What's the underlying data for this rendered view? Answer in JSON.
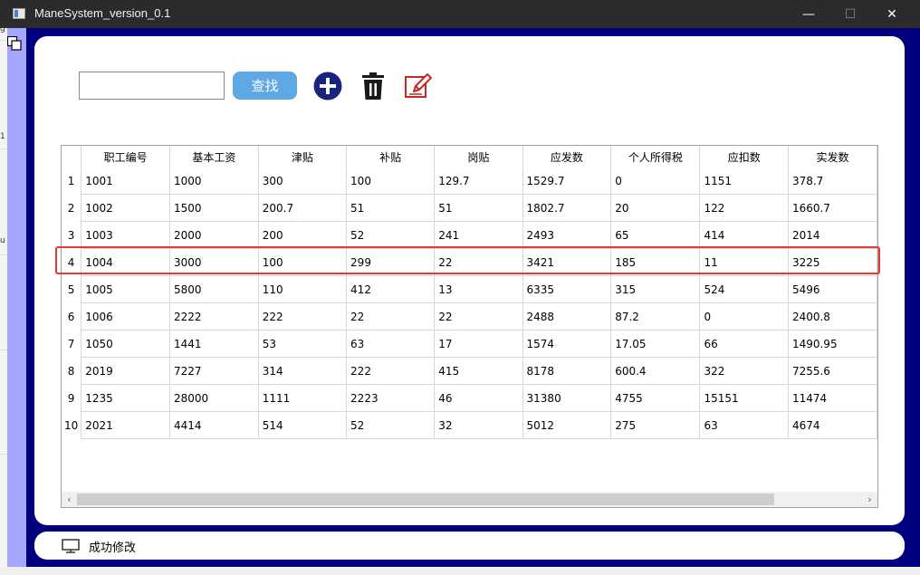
{
  "window": {
    "title": "ManeSystem_version_0.1",
    "min_glyph": "—",
    "max_glyph": "☐",
    "close_glyph": "✕"
  },
  "left_strip_marks": [
    "g",
    "1",
    "u"
  ],
  "toolbar": {
    "search_value": "",
    "search_label": "查找",
    "add_icon": "plus-circle-icon",
    "delete_icon": "trash-icon",
    "edit_icon": "edit-icon"
  },
  "table": {
    "headers": [
      "职工编号",
      "基本工资",
      "津贴",
      "补贴",
      "岗贴",
      "应发数",
      "个人所得税",
      "应扣数",
      "实发数"
    ],
    "rows": [
      {
        "num": "1",
        "cells": [
          "1001",
          "1000",
          "300",
          "100",
          "129.7",
          "1529.7",
          "0",
          "1151",
          "378.7"
        ]
      },
      {
        "num": "2",
        "cells": [
          "1002",
          "1500",
          "200.7",
          "51",
          "51",
          "1802.7",
          "20",
          "122",
          "1660.7"
        ]
      },
      {
        "num": "3",
        "cells": [
          "1003",
          "2000",
          "200",
          "52",
          "241",
          "2493",
          "65",
          "414",
          "2014"
        ]
      },
      {
        "num": "4",
        "cells": [
          "1004",
          "3000",
          "100",
          "299",
          "22",
          "3421",
          "185",
          "11",
          "3225"
        ]
      },
      {
        "num": "5",
        "cells": [
          "1005",
          "5800",
          "110",
          "412",
          "13",
          "6335",
          "315",
          "524",
          "5496"
        ]
      },
      {
        "num": "6",
        "cells": [
          "1006",
          "2222",
          "222",
          "22",
          "22",
          "2488",
          "87.2",
          "0",
          "2400.8"
        ]
      },
      {
        "num": "7",
        "cells": [
          "1050",
          "1441",
          "53",
          "63",
          "17",
          "1574",
          "17.05",
          "66",
          "1490.95"
        ]
      },
      {
        "num": "8",
        "cells": [
          "2019",
          "7227",
          "314",
          "222",
          "415",
          "8178",
          "600.4",
          "322",
          "7255.6"
        ]
      },
      {
        "num": "9",
        "cells": [
          "1235",
          "28000",
          "1111",
          "2223",
          "46",
          "31380",
          "4755",
          "15151",
          "11474"
        ]
      },
      {
        "num": "10",
        "cells": [
          "2021",
          "4414",
          "514",
          "52",
          "32",
          "5012",
          "275",
          "63",
          "4674"
        ]
      }
    ],
    "highlighted_row": "4",
    "highlight_color": "#e53935"
  },
  "scrollbar": {
    "left_glyph": "‹",
    "right_glyph": "›"
  },
  "status": {
    "icon": "monitor-icon",
    "text": "成功修改"
  },
  "colors": {
    "titlebar": "#2b2b2b",
    "frame": "#00007f",
    "side_panel": "#a6a6ff",
    "search_button": "#5fa8e6",
    "add_icon": "#1a237e",
    "edit_icon": "#c62828"
  }
}
